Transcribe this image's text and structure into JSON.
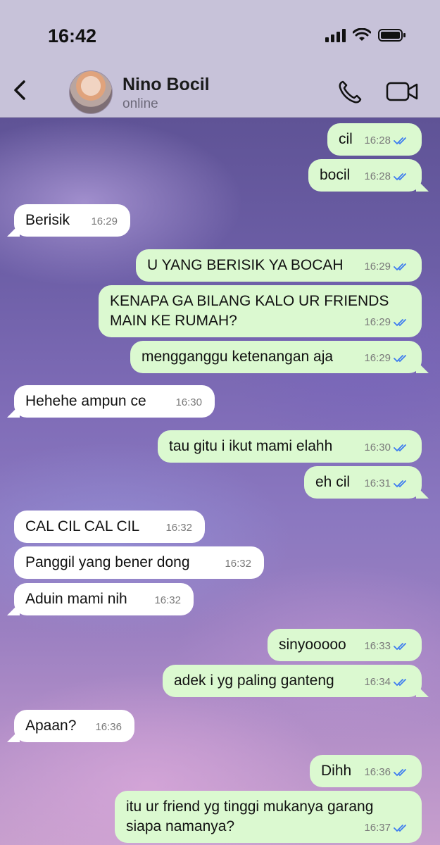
{
  "status_bar": {
    "time": "16:42"
  },
  "header": {
    "contact_name": "Nino Bocil",
    "contact_status": "online"
  },
  "messages": [
    {
      "dir": "out",
      "text": "cil",
      "time": "16:28",
      "read": true
    },
    {
      "dir": "out",
      "text": "bocil",
      "time": "16:28",
      "read": true
    },
    {
      "dir": "in",
      "text": "Berisik",
      "time": "16:29"
    },
    {
      "dir": "out",
      "text": "U YANG BERISIK YA BOCAH",
      "time": "16:29",
      "read": true
    },
    {
      "dir": "out",
      "text": "KENAPA GA BILANG KALO UR FRIENDS MAIN KE RUMAH?",
      "time": "16:29",
      "read": true
    },
    {
      "dir": "out",
      "text": "mengganggu ketenangan aja",
      "time": "16:29",
      "read": true
    },
    {
      "dir": "in",
      "text": "Hehehe ampun ce",
      "time": "16:30"
    },
    {
      "dir": "out",
      "text": "tau gitu i ikut mami elahh",
      "time": "16:30",
      "read": true
    },
    {
      "dir": "out",
      "text": "eh cil",
      "time": "16:31",
      "read": true
    },
    {
      "dir": "in",
      "text": "CAL CIL CAL CIL",
      "time": "16:32"
    },
    {
      "dir": "in",
      "text": "Panggil yang bener dong",
      "time": "16:32"
    },
    {
      "dir": "in",
      "text": "Aduin mami nih",
      "time": "16:32"
    },
    {
      "dir": "out",
      "text": "sinyooooo",
      "time": "16:33",
      "read": true
    },
    {
      "dir": "out",
      "text": "adek i yg paling ganteng",
      "time": "16:34",
      "read": true
    },
    {
      "dir": "in",
      "text": "Apaan?",
      "time": "16:36"
    },
    {
      "dir": "out",
      "text": "Dihh",
      "time": "16:36",
      "read": true
    },
    {
      "dir": "out",
      "text": "itu ur friend yg tinggi mukanya garang siapa namanya?",
      "time": "16:37",
      "read": true
    }
  ],
  "icons": [
    "back-icon",
    "avatar",
    "phone-icon",
    "video-icon",
    "signal-icon",
    "wifi-icon",
    "battery-icon",
    "double-check-icon"
  ],
  "colors": {
    "outgoing_bubble": "#dbf9d0",
    "incoming_bubble": "#ffffff",
    "read_check": "#3d7cf0"
  }
}
